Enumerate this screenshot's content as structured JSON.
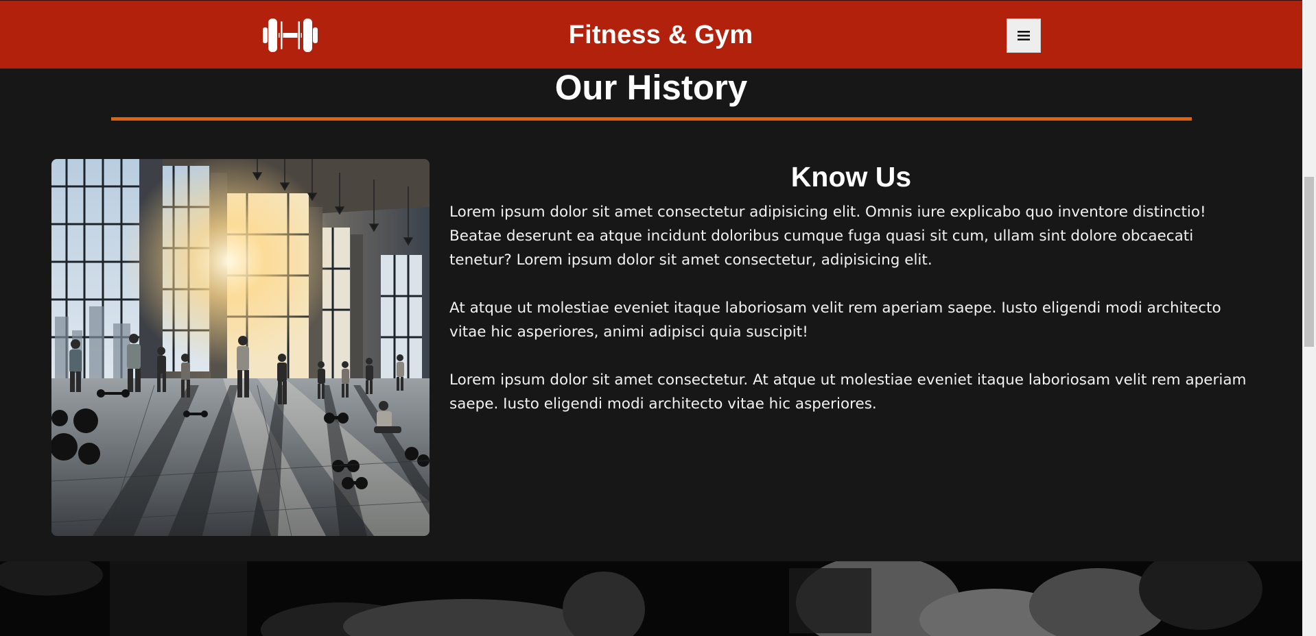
{
  "header": {
    "logo_icon": "dumbbell-icon",
    "title": "Fitness & Gym",
    "menu_icon": "hamburger-menu-icon"
  },
  "history": {
    "title": "Our History",
    "accent_color": "#e0620d",
    "image_alt_icon": "gym-photo",
    "know_title": "Know Us",
    "paragraphs": [
      "Lorem ipsum dolor sit amet consectetur adipisicing elit. Omnis iure explicabo quo inventore distinctio! Beatae deserunt ea atque incidunt doloribus cumque fuga quasi sit cum, ullam sint dolore obcaecati tenetur? Lorem ipsum dolor sit amet consectetur, adipisicing elit.",
      "At atque ut molestiae eveniet itaque laboriosam velit rem aperiam saepe. Iusto eligendi modi architecto vitae hic asperiores, animi adipisci quia suscipit!",
      "Lorem ipsum dolor sit amet consectetur. At atque ut molestiae eveniet itaque laboriosam velit rem aperiam saepe. Iusto eligendi modi architecto vitae hic asperiores."
    ]
  },
  "colors": {
    "header_bg": "#b1210c",
    "page_bg": "#171717",
    "accent": "#e0620d"
  }
}
